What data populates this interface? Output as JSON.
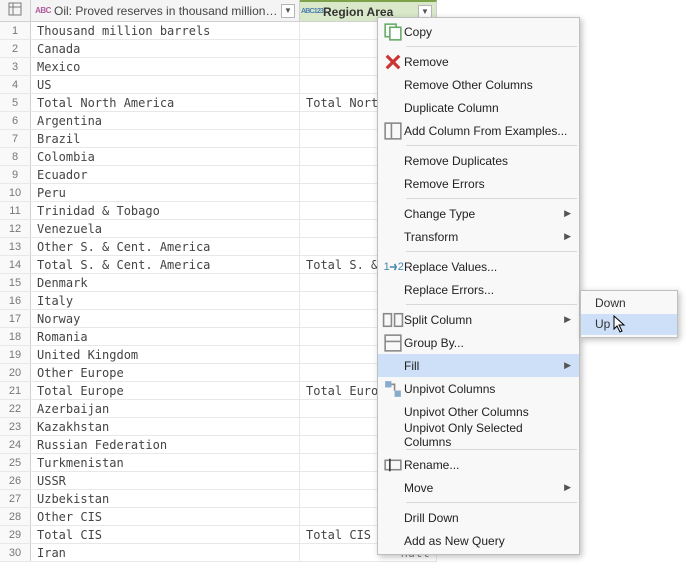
{
  "columns": {
    "col1": {
      "type_icon": "ABC",
      "label": "Oil: Proved reserves in thousand million barrels"
    },
    "col2": {
      "type_icon": "ABC123",
      "label": "Region Area"
    }
  },
  "null_text": "null",
  "rows": [
    {
      "n": 1,
      "a": "Thousand million barrels",
      "b": null
    },
    {
      "n": 2,
      "a": "Canada",
      "b": null
    },
    {
      "n": 3,
      "a": "Mexico",
      "b": null
    },
    {
      "n": 4,
      "a": "US",
      "b": null
    },
    {
      "n": 5,
      "a": "Total North America",
      "b": "Total North"
    },
    {
      "n": 6,
      "a": "Argentina",
      "b": null
    },
    {
      "n": 7,
      "a": "Brazil",
      "b": null
    },
    {
      "n": 8,
      "a": "Colombia",
      "b": null
    },
    {
      "n": 9,
      "a": "Ecuador",
      "b": null
    },
    {
      "n": 10,
      "a": "Peru",
      "b": null
    },
    {
      "n": 11,
      "a": "Trinidad & Tobago",
      "b": null
    },
    {
      "n": 12,
      "a": "Venezuela",
      "b": null
    },
    {
      "n": 13,
      "a": "Other S. & Cent. America",
      "b": null
    },
    {
      "n": 14,
      "a": "Total S. & Cent. America",
      "b": "Total S. & C"
    },
    {
      "n": 15,
      "a": "Denmark",
      "b": null
    },
    {
      "n": 16,
      "a": "Italy",
      "b": null
    },
    {
      "n": 17,
      "a": "Norway",
      "b": null
    },
    {
      "n": 18,
      "a": "Romania",
      "b": null
    },
    {
      "n": 19,
      "a": "United Kingdom",
      "b": null
    },
    {
      "n": 20,
      "a": "Other Europe",
      "b": null
    },
    {
      "n": 21,
      "a": "Total Europe",
      "b": "Total Europe"
    },
    {
      "n": 22,
      "a": "Azerbaijan",
      "b": null
    },
    {
      "n": 23,
      "a": "Kazakhstan",
      "b": null
    },
    {
      "n": 24,
      "a": "Russian Federation",
      "b": null
    },
    {
      "n": 25,
      "a": "Turkmenistan",
      "b": null
    },
    {
      "n": 26,
      "a": "USSR",
      "b": null
    },
    {
      "n": 27,
      "a": "Uzbekistan",
      "b": null
    },
    {
      "n": 28,
      "a": "Other CIS",
      "b": null
    },
    {
      "n": 29,
      "a": "Total CIS",
      "b": "Total CIS"
    },
    {
      "n": 30,
      "a": "Iran",
      "b": null
    }
  ],
  "menu": [
    {
      "t": "item",
      "label": "Copy",
      "icon": "copy"
    },
    {
      "t": "sep"
    },
    {
      "t": "item",
      "label": "Remove",
      "icon": "delete"
    },
    {
      "t": "item",
      "label": "Remove Other Columns"
    },
    {
      "t": "item",
      "label": "Duplicate Column"
    },
    {
      "t": "item",
      "label": "Add Column From Examples...",
      "icon": "col"
    },
    {
      "t": "sep"
    },
    {
      "t": "item",
      "label": "Remove Duplicates"
    },
    {
      "t": "item",
      "label": "Remove Errors"
    },
    {
      "t": "sep"
    },
    {
      "t": "item",
      "label": "Change Type",
      "sub": true
    },
    {
      "t": "item",
      "label": "Transform",
      "sub": true
    },
    {
      "t": "sep"
    },
    {
      "t": "item",
      "label": "Replace Values...",
      "icon": "replace"
    },
    {
      "t": "item",
      "label": "Replace Errors..."
    },
    {
      "t": "sep"
    },
    {
      "t": "item",
      "label": "Split Column",
      "icon": "split",
      "sub": true
    },
    {
      "t": "item",
      "label": "Group By...",
      "icon": "group"
    },
    {
      "t": "item",
      "label": "Fill",
      "sub": true,
      "hl": true
    },
    {
      "t": "item",
      "label": "Unpivot Columns",
      "icon": "unpivot"
    },
    {
      "t": "item",
      "label": "Unpivot Other Columns"
    },
    {
      "t": "item",
      "label": "Unpivot Only Selected Columns"
    },
    {
      "t": "sep"
    },
    {
      "t": "item",
      "label": "Rename...",
      "icon": "rename"
    },
    {
      "t": "item",
      "label": "Move",
      "sub": true
    },
    {
      "t": "sep"
    },
    {
      "t": "item",
      "label": "Drill Down"
    },
    {
      "t": "item",
      "label": "Add as New Query"
    }
  ],
  "submenu": [
    {
      "label": "Down"
    },
    {
      "label": "Up",
      "hl": true
    }
  ]
}
